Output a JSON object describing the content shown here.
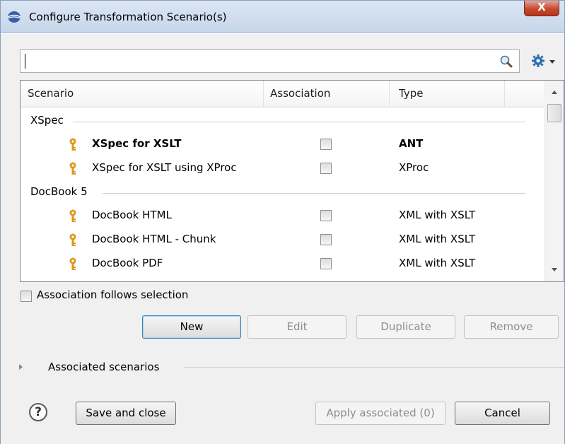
{
  "window": {
    "title": "Configure Transformation Scenario(s)",
    "close_label": "X"
  },
  "search": {
    "value": "",
    "icon": "search-icon"
  },
  "settings": {
    "icon": "gear-icon"
  },
  "table": {
    "columns": [
      "Scenario",
      "Association",
      "Type"
    ],
    "groups": [
      {
        "label": "XSpec",
        "rows": [
          {
            "name": "XSpec for XSLT",
            "type": "ANT",
            "associated": false,
            "bold": true
          },
          {
            "name": "XSpec for XSLT using XProc",
            "type": "XProc",
            "associated": false,
            "bold": false
          }
        ]
      },
      {
        "label": "DocBook 5",
        "rows": [
          {
            "name": "DocBook HTML",
            "type": "XML with XSLT",
            "associated": false,
            "bold": false
          },
          {
            "name": "DocBook HTML - Chunk",
            "type": "XML with XSLT",
            "associated": false,
            "bold": false
          },
          {
            "name": "DocBook PDF",
            "type": "XML with XSLT",
            "associated": false,
            "bold": false
          }
        ]
      }
    ]
  },
  "association_follows_selection": {
    "label": "Association follows selection",
    "checked": false
  },
  "buttons": {
    "new": "New",
    "edit": "Edit",
    "duplicate": "Duplicate",
    "remove": "Remove",
    "save_and_close": "Save and close",
    "apply_associated": "Apply associated (0)",
    "cancel": "Cancel"
  },
  "associated_section": {
    "label": "Associated scenarios"
  },
  "help": {
    "label": "?"
  },
  "colors": {
    "title_bar": "#c6d6ea",
    "close_button": "#c64a33",
    "key_icon": "#d99a1a"
  }
}
